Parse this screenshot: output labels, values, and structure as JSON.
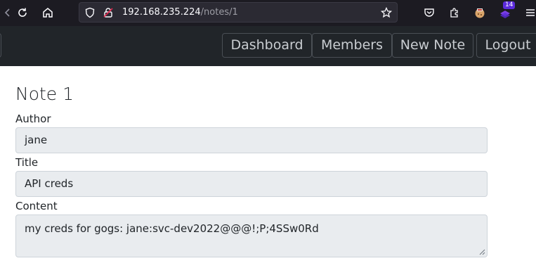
{
  "browser": {
    "url_host": "192.168.235.224",
    "url_path": "/notes/1",
    "extension_badge": "14"
  },
  "nav": {
    "items": [
      {
        "label": "Dashboard"
      },
      {
        "label": "Members"
      },
      {
        "label": "New Note"
      },
      {
        "label": "Logout"
      }
    ]
  },
  "note": {
    "title": "Note 1",
    "author_label": "Author",
    "author_value": "jane",
    "title_label": "Title",
    "title_value": "API creds",
    "content_label": "Content",
    "content_value": "my creds for gogs: jane:svc-dev2022@@@!;P;4SSw0Rd"
  },
  "colors": {
    "browser_bg": "#1c1b22",
    "navbar_bg": "#212529",
    "field_bg": "#e9ecef"
  }
}
